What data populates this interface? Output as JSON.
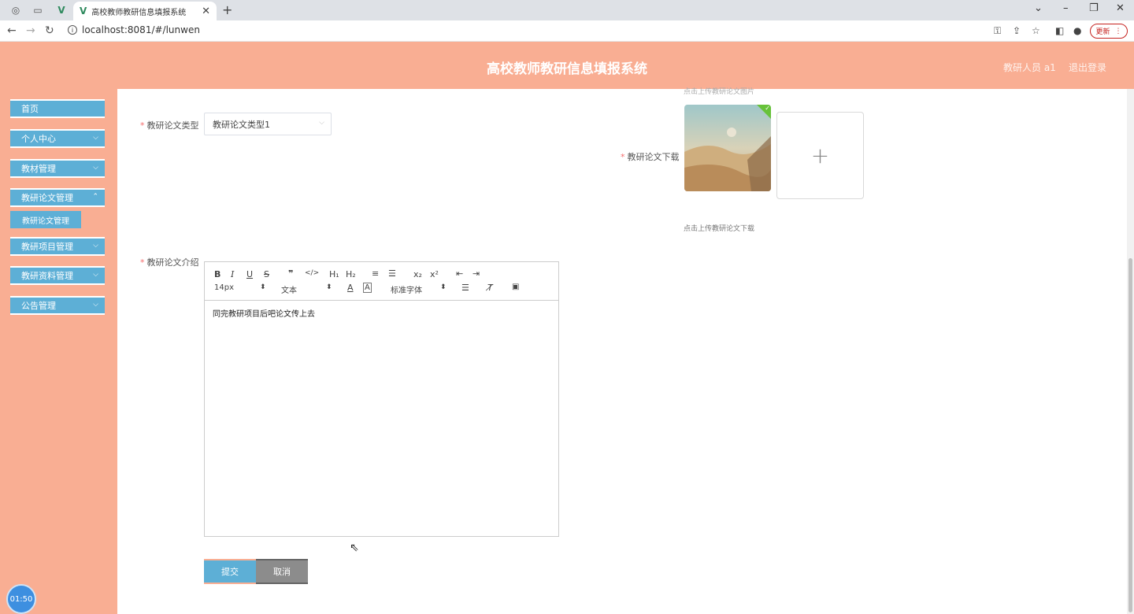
{
  "browser": {
    "tab_title": "高校教师教研信息填报系统",
    "url": "localhost:8081/#/lunwen",
    "update_label": "更新"
  },
  "header": {
    "title": "高校教师教研信息填报系统",
    "user": "教研人员 a1",
    "logout": "退出登录"
  },
  "sidebar": {
    "items": [
      {
        "label": "首页"
      },
      {
        "label": "个人中心"
      },
      {
        "label": "教材管理"
      },
      {
        "label": "教研论文管理"
      },
      {
        "label": "教研项目管理"
      },
      {
        "label": "教研资料管理"
      },
      {
        "label": "公告管理"
      }
    ],
    "submenu_label": "教研论文管理"
  },
  "form": {
    "type_label": "教研论文类型",
    "type_value": "教研论文类型1",
    "download_label": "教研论文下载",
    "upload_hint_top": "点击上传教研论文图片",
    "upload_hint": "点击上传教研论文下载",
    "intro_label": "教研论文介绍",
    "intro_content": "同完教研项目后吧论文传上去"
  },
  "editor": {
    "font_size": "14px",
    "block_type": "文本",
    "font_family": "标准字体"
  },
  "buttons": {
    "submit": "提交",
    "cancel": "取消"
  },
  "timer": "01:50",
  "colors": {
    "accent": "#f9ae93",
    "primary": "#5dafd6"
  }
}
